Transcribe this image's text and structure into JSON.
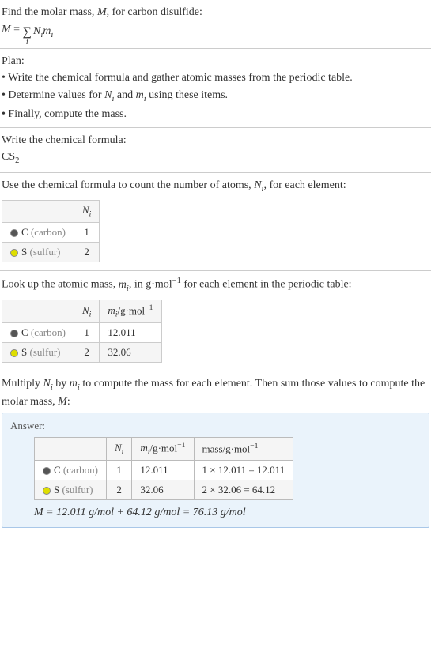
{
  "intro": {
    "prompt": "Find the molar mass, M, for carbon disulfide:",
    "formula_lhs": "M = ",
    "formula_rhs": "NᵢMᵢ"
  },
  "plan": {
    "heading": "Plan:",
    "items": [
      "Write the chemical formula and gather atomic masses from the periodic table.",
      "Determine values for Nᵢ and mᵢ using these items.",
      "Finally, compute the mass."
    ]
  },
  "chem_formula": {
    "prompt": "Write the chemical formula:",
    "formula_base": "CS",
    "formula_sub": "2"
  },
  "count": {
    "prompt": "Use the chemical formula to count the number of atoms, Nᵢ, for each element:",
    "headers": {
      "element": "",
      "n": "Nᵢ"
    },
    "rows": [
      {
        "swatch": "carbon",
        "sym": "C",
        "name": "(carbon)",
        "n": "1"
      },
      {
        "swatch": "sulfur",
        "sym": "S",
        "name": "(sulfur)",
        "n": "2"
      }
    ]
  },
  "masses": {
    "prompt": "Look up the atomic mass, mᵢ, in g·mol⁻¹ for each element in the periodic table:",
    "headers": {
      "element": "",
      "n": "Nᵢ",
      "m": "mᵢ/g·mol⁻¹"
    },
    "rows": [
      {
        "swatch": "carbon",
        "sym": "C",
        "name": "(carbon)",
        "n": "1",
        "m": "12.011"
      },
      {
        "swatch": "sulfur",
        "sym": "S",
        "name": "(sulfur)",
        "n": "2",
        "m": "32.06"
      }
    ]
  },
  "multiply": {
    "prompt": "Multiply Nᵢ by mᵢ to compute the mass for each element. Then sum those values to compute the molar mass, M:"
  },
  "answer": {
    "label": "Answer:",
    "headers": {
      "element": "",
      "n": "Nᵢ",
      "m": "mᵢ/g·mol⁻¹",
      "mass": "mass/g·mol⁻¹"
    },
    "rows": [
      {
        "swatch": "carbon",
        "sym": "C",
        "name": "(carbon)",
        "n": "1",
        "m": "12.011",
        "mass": "1 × 12.011 = 12.011"
      },
      {
        "swatch": "sulfur",
        "sym": "S",
        "name": "(sulfur)",
        "n": "2",
        "m": "32.06",
        "mass": "2 × 32.06 = 64.12"
      }
    ],
    "final": "M = 12.011 g/mol + 64.12 g/mol = 76.13 g/mol"
  }
}
